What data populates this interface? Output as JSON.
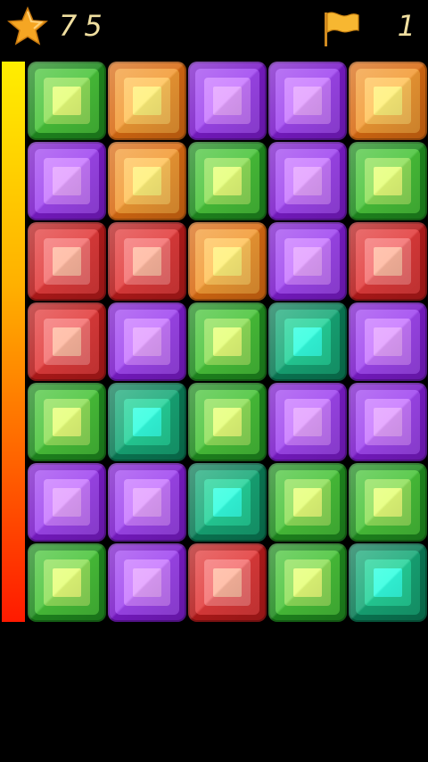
{
  "hud": {
    "score": "75",
    "level": "1",
    "score_icon": "star-icon",
    "level_icon": "flag-icon"
  },
  "time_bar": {
    "fraction_remaining": 1.0,
    "colors": [
      "#ffee00",
      "#ff1a00"
    ]
  },
  "board": {
    "columns": 5,
    "rows": 7,
    "gems": [
      [
        "green",
        "orange",
        "purple",
        "purple",
        "orange"
      ],
      [
        "purple",
        "orange",
        "green",
        "purple",
        "green"
      ],
      [
        "red",
        "red",
        "orange",
        "purple",
        "red"
      ],
      [
        "red",
        "purple",
        "green",
        "teal",
        "purple"
      ],
      [
        "green",
        "teal",
        "green",
        "purple",
        "purple"
      ],
      [
        "purple",
        "purple",
        "teal",
        "green",
        "green"
      ],
      [
        "green",
        "purple",
        "red",
        "green",
        "teal"
      ]
    ]
  },
  "palette": {
    "green": [
      "#1f8a1f",
      "#49c43a",
      "#8fe05a",
      "#e6ff7a"
    ],
    "orange": [
      "#d86a12",
      "#f29a34",
      "#ffc35a",
      "#fff07a"
    ],
    "purple": [
      "#7a1bc8",
      "#a046f0",
      "#c878ff",
      "#e3a0ff"
    ],
    "red": [
      "#b41a1a",
      "#e23b3b",
      "#f47070",
      "#ffb8a0"
    ],
    "teal": [
      "#0a7a55",
      "#17a877",
      "#25d39a",
      "#33ffe0"
    ]
  }
}
